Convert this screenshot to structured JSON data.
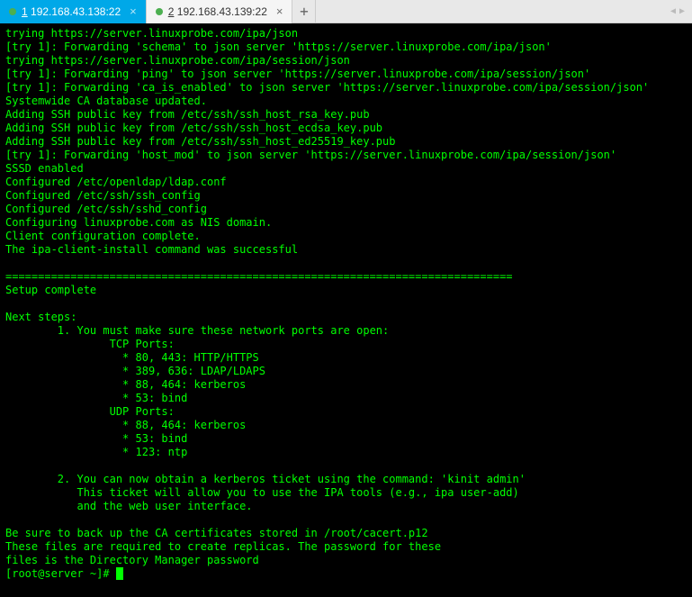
{
  "tabs": {
    "tab1": {
      "index": "1",
      "label": "192.168.43.138:22"
    },
    "tab2": {
      "index": "2",
      "label": "192.168.43.139:22"
    }
  },
  "nav": {
    "left": "◀",
    "right": "▶"
  },
  "terminal": {
    "lines": [
      "trying https://server.linuxprobe.com/ipa/json",
      "[try 1]: Forwarding 'schema' to json server 'https://server.linuxprobe.com/ipa/json'",
      "trying https://server.linuxprobe.com/ipa/session/json",
      "[try 1]: Forwarding 'ping' to json server 'https://server.linuxprobe.com/ipa/session/json'",
      "[try 1]: Forwarding 'ca_is_enabled' to json server 'https://server.linuxprobe.com/ipa/session/json'",
      "Systemwide CA database updated.",
      "Adding SSH public key from /etc/ssh/ssh_host_rsa_key.pub",
      "Adding SSH public key from /etc/ssh/ssh_host_ecdsa_key.pub",
      "Adding SSH public key from /etc/ssh/ssh_host_ed25519_key.pub",
      "[try 1]: Forwarding 'host_mod' to json server 'https://server.linuxprobe.com/ipa/session/json'",
      "SSSD enabled",
      "Configured /etc/openldap/ldap.conf",
      "Configured /etc/ssh/ssh_config",
      "Configured /etc/ssh/sshd_config",
      "Configuring linuxprobe.com as NIS domain.",
      "Client configuration complete.",
      "The ipa-client-install command was successful",
      "",
      "==============================================================================",
      "Setup complete",
      "",
      "Next steps:",
      "        1. You must make sure these network ports are open:",
      "                TCP Ports:",
      "                  * 80, 443: HTTP/HTTPS",
      "                  * 389, 636: LDAP/LDAPS",
      "                  * 88, 464: kerberos",
      "                  * 53: bind",
      "                UDP Ports:",
      "                  * 88, 464: kerberos",
      "                  * 53: bind",
      "                  * 123: ntp",
      "",
      "        2. You can now obtain a kerberos ticket using the command: 'kinit admin'",
      "           This ticket will allow you to use the IPA tools (e.g., ipa user-add)",
      "           and the web user interface.",
      "",
      "Be sure to back up the CA certificates stored in /root/cacert.p12",
      "These files are required to create replicas. The password for these",
      "files is the Directory Manager password"
    ],
    "prompt": "[root@server ~]# "
  }
}
